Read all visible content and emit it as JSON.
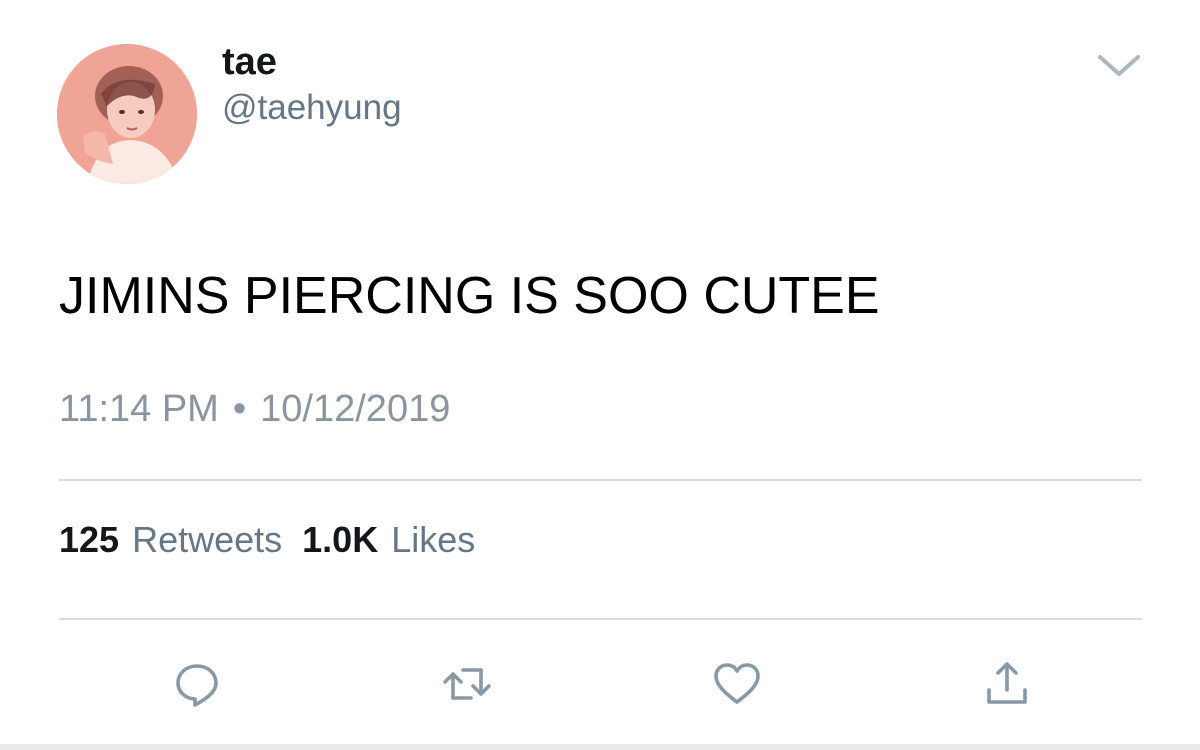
{
  "tweet": {
    "display_name": "tae",
    "handle": "@taehyung",
    "text": "JIMINS PIERCING IS SOO CUTEE",
    "time": "11:14 PM",
    "separator": "•",
    "date": "10/12/2019"
  },
  "stats": {
    "retweets_count": "125",
    "retweets_label": "Retweets",
    "likes_count": "1.0K",
    "likes_label": "Likes"
  },
  "actions": [
    {
      "name": "reply",
      "icon": "reply-icon"
    },
    {
      "name": "retweet",
      "icon": "retweet-icon"
    },
    {
      "name": "like",
      "icon": "heart-icon"
    },
    {
      "name": "share",
      "icon": "share-icon"
    }
  ],
  "colors": {
    "name": "#14171a",
    "secondary": "#657786",
    "timestamp": "#8a959f",
    "divider": "#d8dde1",
    "icon": "#8899a6",
    "avatar_tint": "#ec9a8c"
  }
}
